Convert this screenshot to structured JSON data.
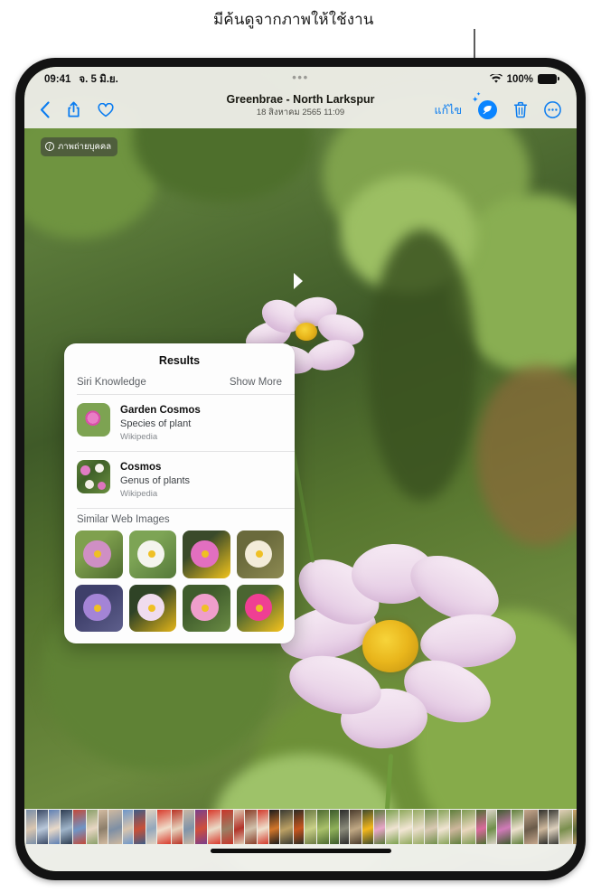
{
  "callout": {
    "text": "มีค้นดูจากภาพให้ใช้งาน",
    "pointer_target": "visual-lookup-button"
  },
  "status_bar": {
    "time": "09:41",
    "date": "จ. 5 มิ.ย.",
    "wifi_icon": "wifi-icon",
    "battery_percent": "100%",
    "battery_icon": "battery-full-icon",
    "grabber": "•••"
  },
  "nav_bar": {
    "back_icon": "chevron-left-icon",
    "share_icon": "share-icon",
    "favorite_icon": "heart-icon",
    "title": "Greenbrae - North Larkspur",
    "subtitle": "18 สิงหาคม 2565  11:09",
    "edit_label": "แก้ไข",
    "lookup_icon": "visual-lookup-leaf-icon",
    "trash_icon": "trash-icon",
    "more_icon": "more-ellipsis-icon",
    "accent_color": "#0a84ff"
  },
  "photo": {
    "badge_label": "ภาพถ่ายบุคคล",
    "badge_icon": "aperture-f-icon",
    "subject": "pink cosmos flower in a garden"
  },
  "popover": {
    "title": "Results",
    "section_label": "Siri Knowledge",
    "show_more_label": "Show More",
    "items": [
      {
        "name": "Garden Cosmos",
        "description": "Species of plant",
        "source": "Wikipedia",
        "thumb": "pink-cosmos-thumb"
      },
      {
        "name": "Cosmos",
        "description": "Genus of plants",
        "source": "Wikipedia",
        "thumb": "cosmos-field-thumb"
      }
    ],
    "similar_label": "Similar Web Images",
    "similar_images": [
      {
        "name": "pink cosmos in green foliage",
        "c1": "#7fa04e",
        "c2": "#cf8fc4",
        "c3": "#4d6a2e"
      },
      {
        "name": "white cosmos cluster",
        "c1": "#7da455",
        "c2": "#f4f4ee",
        "c3": "#55793a"
      },
      {
        "name": "single magenta cosmos closeup",
        "c1": "#3a4a2a",
        "c2": "#e26fc0",
        "c3": "#f1c41c"
      },
      {
        "name": "cream cosmos blossoms",
        "c1": "#6a6a3c",
        "c2": "#f3ecd9",
        "c3": "#8d8a52"
      },
      {
        "name": "purple cosmos on dark bed",
        "c1": "#3e3f6a",
        "c2": "#a484d6",
        "c3": "#5e5f8c"
      },
      {
        "name": "pale pink cosmos closeup",
        "c1": "#2f4326",
        "c2": "#f0dcee",
        "c3": "#e3b519"
      },
      {
        "name": "pink cosmos field",
        "c1": "#3f5c2c",
        "c2": "#ef9ecb",
        "c3": "#6a8b44"
      },
      {
        "name": "bright pink cosmos bunch",
        "c1": "#4a6531",
        "c2": "#ef3f93",
        "c3": "#f6c31d"
      }
    ]
  },
  "filmstrip": {
    "label": "photo-filmstrip",
    "thumbs": [
      {
        "c1": "#7a8fa8",
        "c2": "#d9c6b0"
      },
      {
        "c1": "#3b4a66",
        "c2": "#b9c8da"
      },
      {
        "c1": "#5d7fb4",
        "c2": "#e8d9c8"
      },
      {
        "c1": "#2e3d52",
        "c2": "#9fb4c9"
      },
      {
        "c1": "#c24a3a",
        "c2": "#6f95c6"
      },
      {
        "c1": "#8ba06a",
        "c2": "#e7d6c3"
      },
      {
        "c1": "#d3bba1",
        "c2": "#8d7f6b"
      },
      {
        "c1": "#cfb9a0",
        "c2": "#7e8fa4"
      },
      {
        "c1": "#6e97c9",
        "c2": "#d8c4ad"
      },
      {
        "c1": "#3f5d86",
        "c2": "#c75038"
      },
      {
        "c1": "#e0d2c0",
        "c2": "#93a7bc"
      },
      {
        "c1": "#d83b2c",
        "c2": "#f0ddca"
      },
      {
        "c1": "#b83224",
        "c2": "#e7d3bd"
      },
      {
        "c1": "#c9b7a4",
        "c2": "#7f93a8"
      },
      {
        "c1": "#7a3f8c",
        "c2": "#cf4f3c"
      },
      {
        "c1": "#d8382a",
        "c2": "#eadbc7"
      },
      {
        "c1": "#c7352a",
        "c2": "#9a7f64"
      },
      {
        "c1": "#e0cbb4",
        "c2": "#b2342a"
      },
      {
        "c1": "#8a3e2a",
        "c2": "#d0c0aa"
      },
      {
        "c1": "#d23a2c",
        "c2": "#efe0cc"
      },
      {
        "c1": "#1b1b1b",
        "c2": "#d2762a"
      },
      {
        "c1": "#3a3a32",
        "c2": "#bba064"
      },
      {
        "c1": "#2b2b22",
        "c2": "#c6561f"
      },
      {
        "c1": "#6b7a44",
        "c2": "#c8cf86"
      },
      {
        "c1": "#4e6b32",
        "c2": "#a9c06a"
      },
      {
        "c1": "#3c5a2c",
        "c2": "#8fb05a"
      },
      {
        "c1": "#2b2b2b",
        "c2": "#8a8a7a"
      },
      {
        "c1": "#4a3b2c",
        "c2": "#c0a884"
      },
      {
        "c1": "#3f4a2c",
        "c2": "#f3b71c"
      },
      {
        "c1": "#5a7a3a",
        "c2": "#e8a6c8"
      },
      {
        "c1": "#7ba04e",
        "c2": "#efe3d2"
      },
      {
        "c1": "#8fa95c",
        "c2": "#f2e6d4"
      },
      {
        "c1": "#95ab63",
        "c2": "#e9ddc9"
      },
      {
        "c1": "#6f8f4a",
        "c2": "#d8c8b2"
      },
      {
        "c1": "#86a358",
        "c2": "#f0e4d2"
      },
      {
        "c1": "#5f7f3c",
        "c2": "#cdb79c"
      },
      {
        "c1": "#7d9b52",
        "c2": "#ead7be"
      },
      {
        "c1": "#4f7032",
        "c2": "#d96a9c"
      },
      {
        "c1": "#d9d2c6",
        "c2": "#6f8f4a"
      },
      {
        "c1": "#3f5c2e",
        "c2": "#d07ab8"
      },
      {
        "c1": "#5f7f3c",
        "c2": "#ece0cd"
      },
      {
        "c1": "#c6a78c",
        "c2": "#6a5b4a"
      },
      {
        "c1": "#2f2f2b",
        "c2": "#cdb79c"
      },
      {
        "c1": "#3b3b36",
        "c2": "#dccfbc"
      },
      {
        "c1": "#e0cfb8",
        "c2": "#7a8f4e"
      },
      {
        "c1": "#caa36a",
        "c2": "#5a6b3a"
      },
      {
        "c1": "#e8a33c",
        "c2": "#9a5a2a"
      },
      {
        "c1": "#d9832a",
        "c2": "#e8d4b8"
      }
    ]
  },
  "home_indicator": "home-indicator-bar"
}
